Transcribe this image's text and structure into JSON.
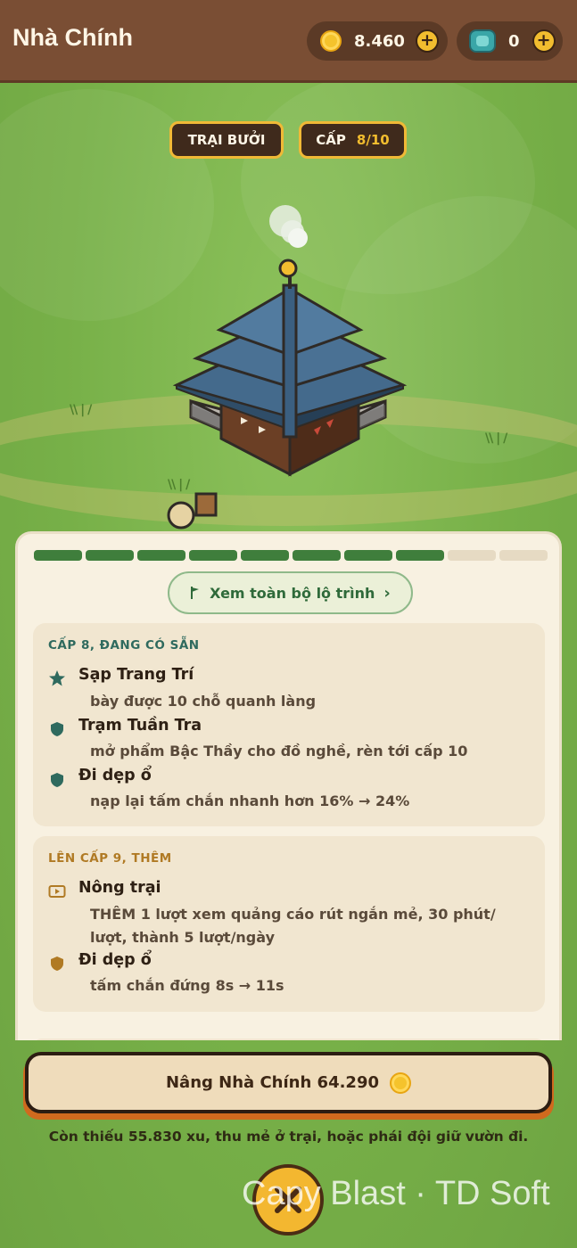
{
  "header": {
    "title": "Nhà Chính",
    "coins": "8.460",
    "gems": "0",
    "plus_label": "+"
  },
  "chips": {
    "camp": "TRẠI BƯỞI",
    "level_label": "CẤP",
    "level_value": "8/10"
  },
  "progress": {
    "filled": 8,
    "total": 10
  },
  "route_button": "Xem toàn bộ lộ trình",
  "current": {
    "heading": "CẤP 8, ĐANG CÓ SẴN",
    "items": [
      {
        "icon": "star-icon",
        "name": "Sạp Trang Trí",
        "desc": "bày được 10 chỗ quanh làng"
      },
      {
        "icon": "shield-icon",
        "name": "Trạm Tuần Tra",
        "desc": "mở phẩm Bậc Thầy cho đồ nghề, rèn tới cấp 10"
      },
      {
        "icon": "shield-icon",
        "name": "Đi dẹp ổ",
        "desc": "nạp lại tấm chắn nhanh hơn 16% → 24%"
      }
    ]
  },
  "next": {
    "heading": "LÊN CẤP 9, THÊM",
    "items": [
      {
        "icon": "video-icon",
        "name": "Nông trại",
        "desc": "THÊM 1 lượt xem quảng cáo rút ngắn mẻ, 30 phút/ lượt, thành 5 lượt/ngày"
      },
      {
        "icon": "shield-icon",
        "name": "Đi dẹp ổ",
        "desc": "tấm chắn đứng 8s → 11s"
      }
    ]
  },
  "upgrade": {
    "label": "Nâng Nhà Chính 64.290"
  },
  "hint": "Còn thiếu 55.830 xu, thu mẻ ở trại, hoặc phái đội giữ vườn đi.",
  "watermark": "Capy Blast · TD Soft",
  "colors": {
    "header_bg": "#7a4e34",
    "accent_gold": "#f2bd2f",
    "progress_on": "#3f7e3c",
    "upgrade_bg": "#efdcbb",
    "heading_green": "#2f6a5e",
    "heading_gold": "#b07a24"
  }
}
